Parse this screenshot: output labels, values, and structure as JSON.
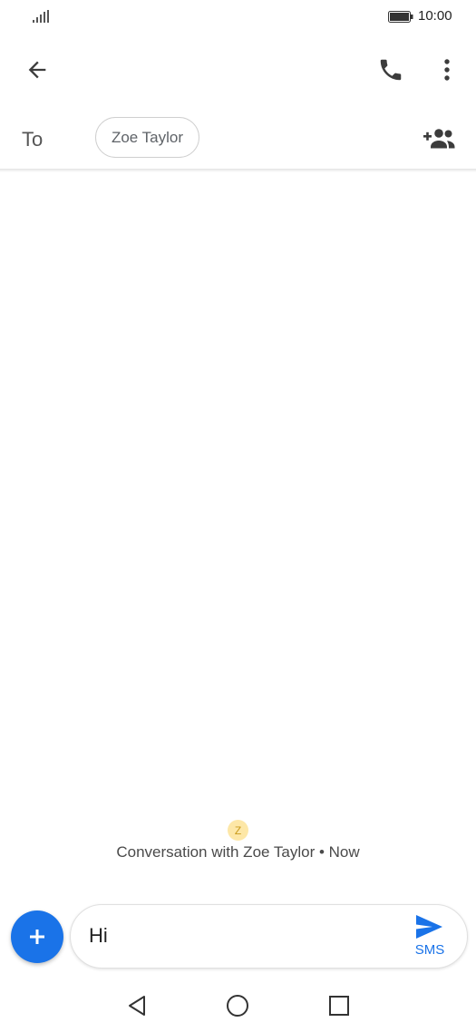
{
  "status_bar": {
    "time": "10:00",
    "icons": [
      "signal-icon",
      "battery-icon"
    ]
  },
  "app_bar": {
    "icons": [
      "back-arrow-icon",
      "phone-icon",
      "more-vert-icon"
    ]
  },
  "recipient": {
    "to_label": "To",
    "chip_label": "Zoe Taylor",
    "add_icon": "add-contact-icon"
  },
  "conversation": {
    "avatar_letter": "Z",
    "info": "Conversation with Zoe Taylor • Now"
  },
  "compose": {
    "attach_icon": "plus-icon",
    "message_value": "Hi",
    "send_icon": "send-icon",
    "send_label": "SMS"
  },
  "nav_bar": {
    "icons": [
      "nav-back-icon",
      "nav-home-icon",
      "nav-recents-icon"
    ]
  },
  "colors": {
    "accent": "#1a73e8",
    "avatar_bg": "#fde7a7",
    "icon": "#3c3c3c"
  }
}
